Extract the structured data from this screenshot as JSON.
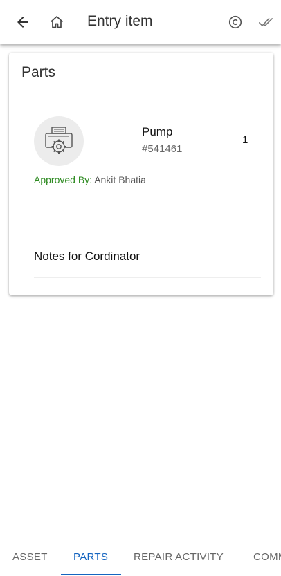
{
  "header": {
    "title": "Entry item",
    "back_icon": "arrow-left-icon",
    "home_icon": "home-icon",
    "refresh_icon": "copyright-circle-icon",
    "approve_icon": "double-check-icon"
  },
  "card": {
    "title": "Parts",
    "part": {
      "icon": "printer-gear-icon",
      "name": "Pump",
      "number": "#541461",
      "quantity": "1",
      "approved_label": "Approved By:",
      "approved_name": "Ankit Bhatia"
    },
    "notes_label": "Notes for Cordinator"
  },
  "tabs": [
    {
      "label": "ASSET",
      "active": false
    },
    {
      "label": "PARTS",
      "active": true
    },
    {
      "label": "REPAIR ACTIVITY",
      "active": false
    },
    {
      "label": "COMMENTS",
      "active": false
    }
  ],
  "colors": {
    "accent": "#1565c0",
    "approved": "#2e8b22"
  }
}
